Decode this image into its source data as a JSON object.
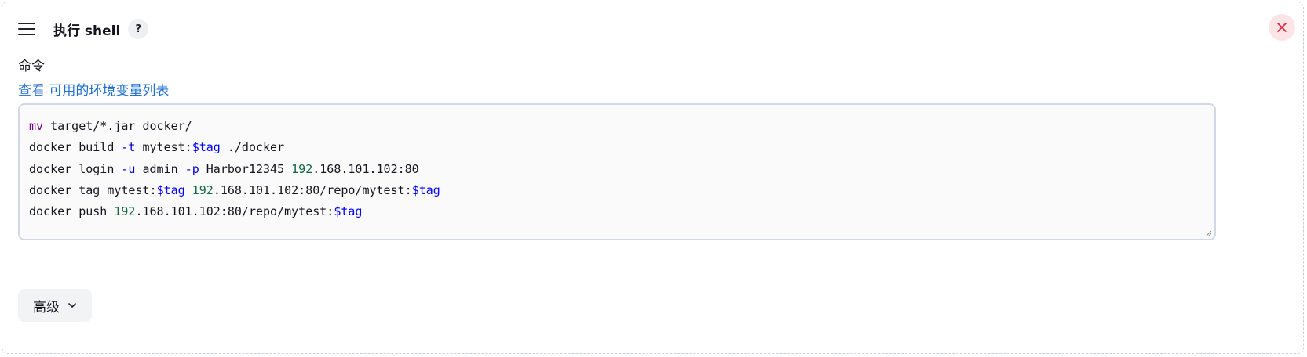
{
  "step": {
    "title": "执行 shell",
    "help_label": "?",
    "drag_icon": "drag-handle-icon",
    "close_icon": "close-icon",
    "close_color": "#e0293a"
  },
  "command": {
    "label": "命令",
    "env_prefix": "查看",
    "env_link": "可用的环境变量列表",
    "lines": [
      [
        [
          "kw",
          "mv"
        ],
        [
          "t",
          " target/*.jar docker/"
        ]
      ],
      [
        [
          "t",
          "docker build "
        ],
        [
          "flag",
          "-t"
        ],
        [
          "t",
          " mytest:"
        ],
        [
          "var",
          "$tag"
        ],
        [
          "t",
          " ./docker"
        ]
      ],
      [
        [
          "t",
          "docker login "
        ],
        [
          "flag",
          "-u"
        ],
        [
          "t",
          " admin "
        ],
        [
          "flag",
          "-p"
        ],
        [
          "t",
          " Harbor12345 "
        ],
        [
          "num",
          "192"
        ],
        [
          "t",
          ".168.101.102:80"
        ]
      ],
      [
        [
          "t",
          "docker tag mytest:"
        ],
        [
          "var",
          "$tag"
        ],
        [
          "t",
          " "
        ],
        [
          "num",
          "192"
        ],
        [
          "t",
          ".168.101.102:80/repo/mytest:"
        ],
        [
          "var",
          "$tag"
        ]
      ],
      [
        [
          "t",
          "docker push "
        ],
        [
          "num",
          "192"
        ],
        [
          "t",
          ".168.101.102:80/repo/mytest:"
        ],
        [
          "var",
          "$tag"
        ]
      ]
    ]
  },
  "advanced": {
    "label": "高级",
    "icon": "chevron-down-icon"
  }
}
